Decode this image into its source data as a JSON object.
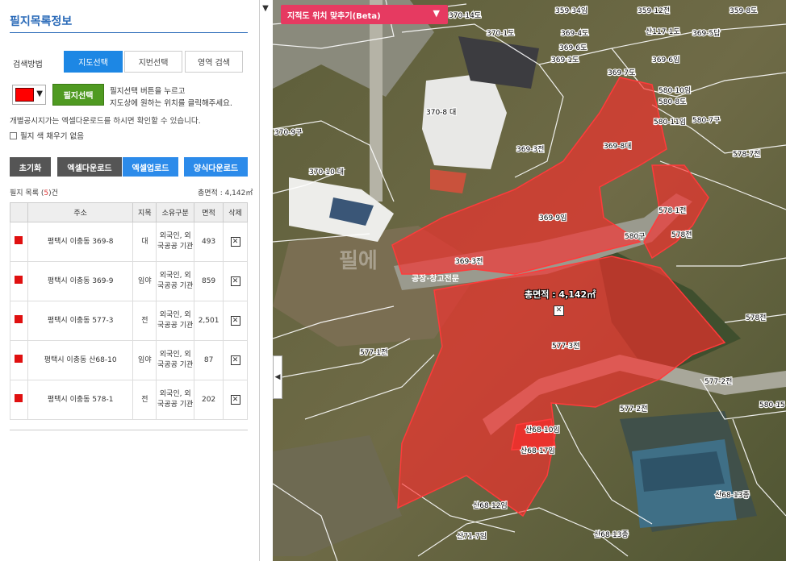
{
  "panel": {
    "title": "필지목록정보",
    "search_label": "검색방법",
    "tabs": [
      {
        "label": "지도선택",
        "active": true
      },
      {
        "label": "지번선택",
        "active": false
      },
      {
        "label": "영역 검색",
        "active": false
      }
    ],
    "selected_color": "#ff0000",
    "select_parcel_label": "필지선택",
    "hint_line1": "필지선택 버튼을 누르고",
    "hint_line2": "지도상에 원하는 위치를 클릭해주세요.",
    "info_line": "개별공시지가는 엑셀다운로드를 하시면 확인할 수 있습니다.",
    "no_fill_label": "필지 색 채우기 없음",
    "reset_label": "초기화",
    "excel_download_label": "엑셀다운로드",
    "excel_upload_label": "엑셀업로드",
    "form_download_label": "양식다운로드",
    "list_prefix": "필지 목록 (",
    "list_count": "5",
    "list_suffix": ")건",
    "total_area": "총면적 : 4,142㎡"
  },
  "table": {
    "headers": [
      "",
      "주소",
      "지목",
      "소유구분",
      "면적",
      "삭제"
    ],
    "rows": [
      {
        "address": "평택시 이충동 369-8",
        "category": "대",
        "owner": "외국인, 외국공공 기관",
        "area": "493"
      },
      {
        "address": "평택시 이충동 369-9",
        "category": "임야",
        "owner": "외국인, 외국공공 기관",
        "area": "859"
      },
      {
        "address": "평택시 이충동 577-3",
        "category": "전",
        "owner": "외국인, 외국공공 기관",
        "area": "2,501"
      },
      {
        "address": "평택시 이충동 산68-10",
        "category": "임야",
        "owner": "외국인, 외국공공 기관",
        "area": "87"
      },
      {
        "address": "평택시 이충동 578-1",
        "category": "전",
        "owner": "외국인, 외국공공 기관",
        "area": "202"
      }
    ]
  },
  "map": {
    "beta_label": "지적도 위치 맞추기(Beta)",
    "total_area_label": "총면적 : 4,142㎡",
    "watermark_text": "필에",
    "watermark_sub": "공장·창고전문",
    "parcel_labels": [
      "370-14도",
      "359-34임",
      "359-12전",
      "359-8도",
      "370-1도",
      "369-4도",
      "산117-1도",
      "369-5답",
      "369-6도",
      "369-1도",
      "369-7도",
      "369-6임",
      "580-10임",
      "580-8도",
      "370-8 대",
      "369-3전",
      "369-8대",
      "580-11임",
      "580-7구",
      "370-9구",
      "578-7전",
      "370-10 대",
      "369-9임",
      "578-1전",
      "578전",
      "580구",
      "369-3전",
      "578전",
      "577-1전",
      "577-3전",
      "577-2전",
      "577-2전",
      "산68-10임",
      "산68-17임",
      "산68-12임",
      "산71-7임",
      "산68-13종",
      "산68-13종",
      "580-15"
    ],
    "colors": {
      "parcel_fill": "#ff2a2a",
      "aerial": "#6b6a45"
    }
  }
}
